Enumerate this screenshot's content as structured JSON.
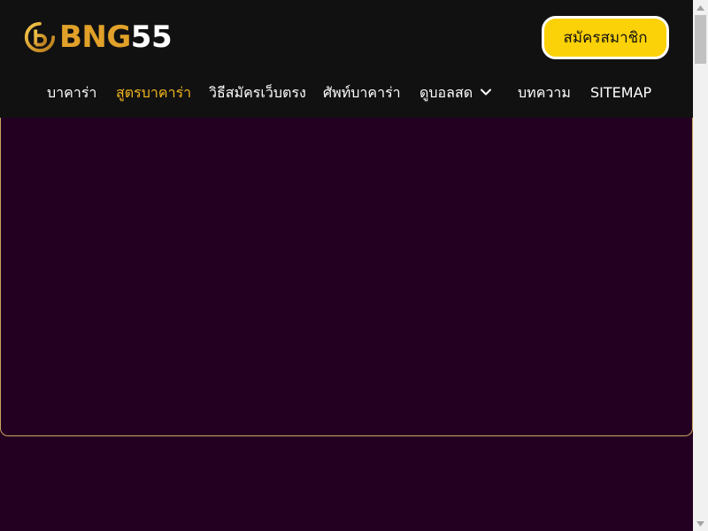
{
  "header": {
    "logo": {
      "text_part1": "BNG",
      "text_part2": "55",
      "icon": "b-coin-logo-icon"
    },
    "signup_button": {
      "label": "สมัครสมาชิก"
    }
  },
  "nav": {
    "items": [
      {
        "label": "บาคาร่า",
        "active": false
      },
      {
        "label": "สูตรบาคาร่า",
        "active": true
      },
      {
        "label": "วิธีสมัครเว็บตรง",
        "active": false
      },
      {
        "label": "ศัพท์บาคาร่า",
        "active": false
      },
      {
        "label": "ดูบอลสด",
        "active": false,
        "has_dropdown": true,
        "dropdown_icon": "chevron-down-icon"
      },
      {
        "label": "บทความ",
        "active": false
      },
      {
        "label": "SITEMAP",
        "active": false
      }
    ]
  },
  "colors": {
    "header_bg": "#111111",
    "page_bg": "#230021",
    "accent_gold": "#e1a129",
    "active_nav": "#f2b51f",
    "button_yellow": "#fbd108",
    "card_border": "#c9a45c"
  },
  "scrollbar": {
    "up_icon": "scroll-up-arrow-icon",
    "down_icon": "scroll-down-arrow-icon"
  }
}
